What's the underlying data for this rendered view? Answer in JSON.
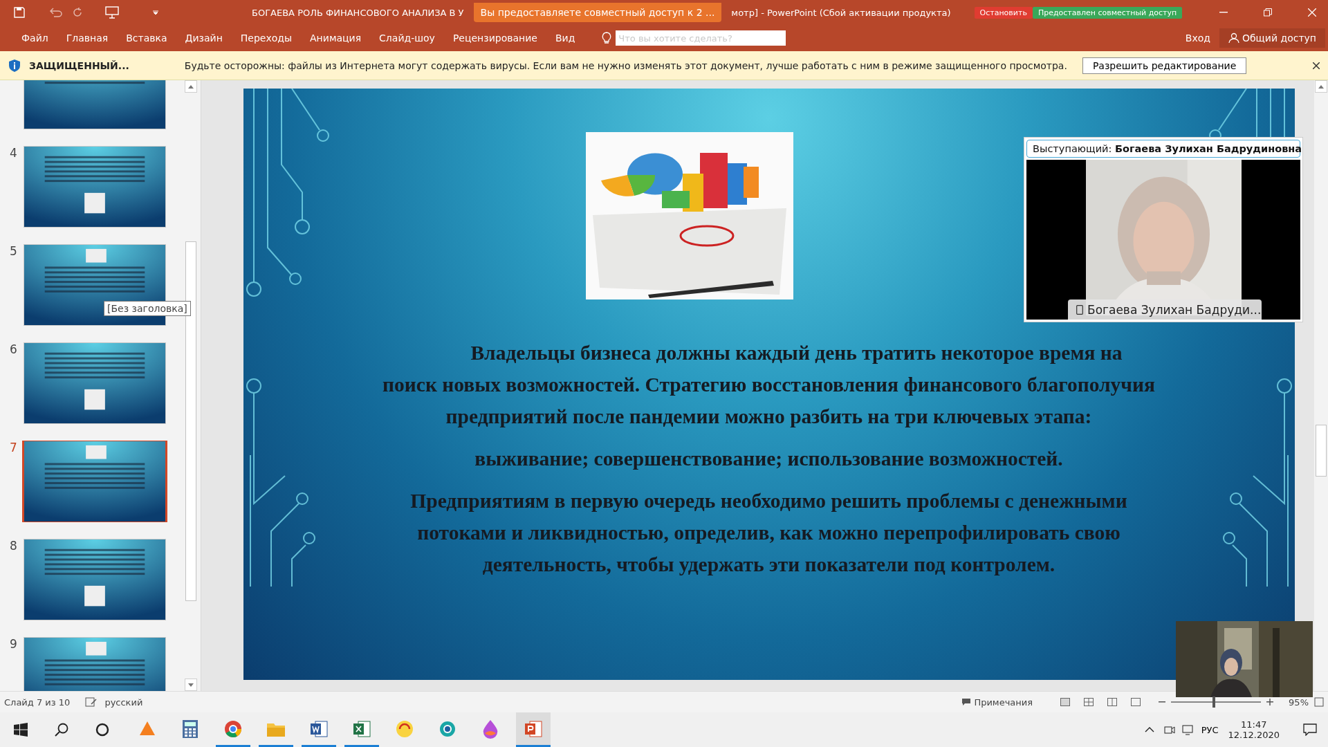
{
  "title_bar": {
    "title": "БОГАЕВА РОЛЬ ФИНАНСОВОГО АНАЛИЗА В У",
    "title_end": "мотр] - PowerPoint (Сбой активации продукта)",
    "share_banner": "Вы предоставляете совместный доступ к 2 ...",
    "stop_button": "Остановить",
    "sharing_status": "Предоставлен совместный доступ"
  },
  "ribbon": {
    "tabs": [
      {
        "label": "Файл",
        "selected": false
      },
      {
        "label": "Главная",
        "selected": false
      },
      {
        "label": "Вставка",
        "selected": false
      },
      {
        "label": "Дизайн",
        "selected": false
      },
      {
        "label": "Переходы",
        "selected": false
      },
      {
        "label": "Анимация",
        "selected": false
      },
      {
        "label": "Слайд-шоу",
        "selected": false
      },
      {
        "label": "Рецензирование",
        "selected": false
      },
      {
        "label": "Вид",
        "selected": false
      }
    ],
    "search": {
      "placeholder": "Что вы хотите сделать?"
    },
    "sign_in": "Вход",
    "share": "Общий доступ"
  },
  "protected_bar": {
    "title": "ЗАЩИЩЕННЫЙ...",
    "message": "Будьте осторожны: файлы из Интернета могут содержать вирусы. Если вам не нужно изменять этот документ, лучше работать с ним в режиме защищенного просмотра.",
    "button": "Разрешить редактирование"
  },
  "thumbnails": {
    "items": [
      {
        "kind": "clipped",
        "selected": false
      },
      {
        "number": "4",
        "selected": false
      },
      {
        "number": "5",
        "kind": "top-image",
        "selected": false
      },
      {
        "number": "6",
        "selected": false
      },
      {
        "number": "7",
        "kind": "top-image",
        "selected": true
      },
      {
        "number": "8",
        "selected": false
      },
      {
        "number": "9",
        "kind": "top-image",
        "selected": false
      }
    ],
    "tooltip": "[Без заголовка]"
  },
  "slide": {
    "paragraphs": [
      {
        "lines": [
          "Владельцы бизнеса должны каждый день тратить некоторое время на",
          "поиск новых возможностей. Стратегию восстановления финансового благополучия",
          "предприятий после пандемии можно разбить на три ключевых этапа:"
        ]
      },
      {
        "lines": [
          "выживание; совершенствование; использование возможностей."
        ]
      },
      {
        "lines": [
          "Предприятиям в первую очередь необходимо решить проблемы с денежными",
          "потоками и ликвидностью, определив, как можно перепрофилировать свою",
          "деятельность, чтобы удержать эти показатели под контролем."
        ]
      }
    ]
  },
  "speaker": {
    "label": "Выступающий: **Богаева Зулихан Бадрудиновна**",
    "caption": "Богаева Зулихан Бадруди..."
  },
  "status_bar": {
    "slide": "Слайд 7 из 10",
    "language": "русский",
    "notes": "Примечания",
    "zoom": {
      "level": 0.48
    },
    "zoom_value": "95%"
  },
  "taskbar": {
    "apps": [
      {
        "kind": "antivirus",
        "running": false,
        "selected": false
      },
      {
        "kind": "calculator",
        "running": false,
        "selected": false
      },
      {
        "kind": "browser",
        "running": true,
        "selected": false
      },
      {
        "kind": "folder",
        "running": true,
        "selected": false
      },
      {
        "kind": "word",
        "running": true,
        "selected": false
      },
      {
        "kind": "excel",
        "running": true,
        "selected": false
      },
      {
        "kind": "accounting",
        "running": false,
        "selected": false
      },
      {
        "kind": "ring",
        "running": false,
        "selected": false
      },
      {
        "kind": "drop",
        "running": false,
        "selected": false
      },
      {
        "kind": "powerpoint",
        "running": true,
        "selected": true
      }
    ],
    "language": "РУС",
    "time": "11:47",
    "date": "12.12.2020"
  }
}
